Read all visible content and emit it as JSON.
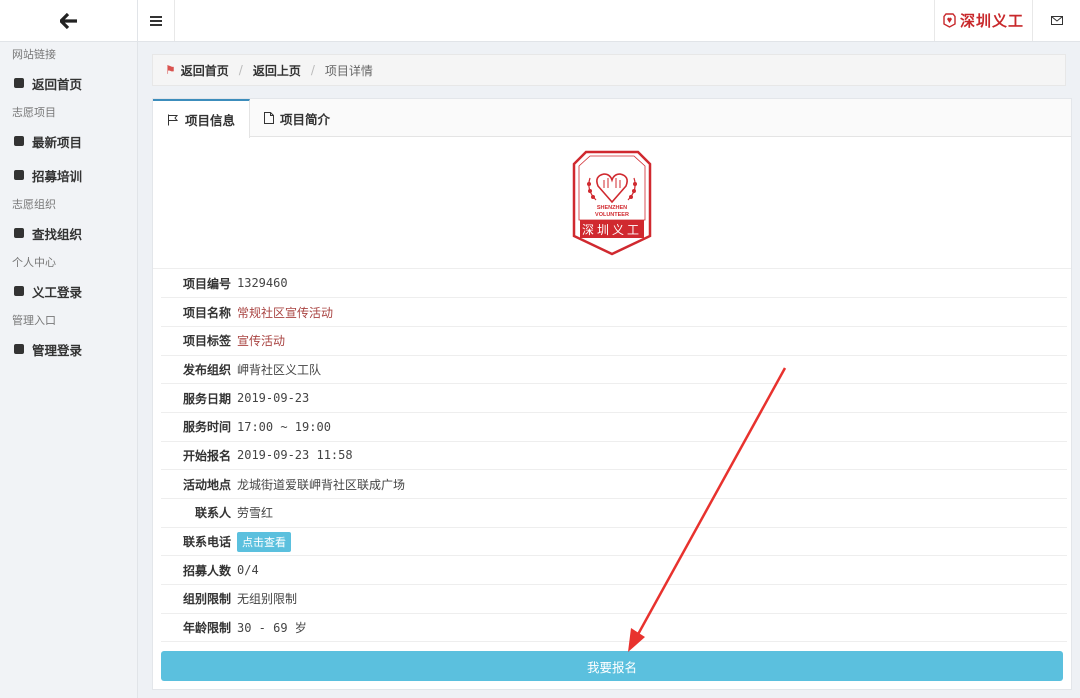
{
  "sidebar": {
    "sections": [
      {
        "title": "网站链接",
        "items": [
          {
            "label": "返回首页"
          }
        ]
      },
      {
        "title": "志愿项目",
        "items": [
          {
            "label": "最新项目"
          },
          {
            "label": "招募培训"
          }
        ]
      },
      {
        "title": "志愿组织",
        "items": [
          {
            "label": "查找组织"
          }
        ]
      },
      {
        "title": "个人中心",
        "items": [
          {
            "label": "义工登录"
          }
        ]
      },
      {
        "title": "管理入口",
        "items": [
          {
            "label": "管理登录"
          }
        ]
      }
    ]
  },
  "topbar": {
    "brand": "深圳义工",
    "menu_icon": "hamburger-icon",
    "mail_icon": "mail-icon"
  },
  "breadcrumb": {
    "home": "返回首页",
    "prev": "返回上页",
    "current": "项目详情"
  },
  "tabs": [
    {
      "label": "项目信息",
      "icon": "flag-icon"
    },
    {
      "label": "项目简介",
      "icon": "file-icon"
    }
  ],
  "logo": {
    "line1": "SHENZHEN",
    "line2": "VOLUNTEER",
    "name": "深圳义工"
  },
  "fields": {
    "id": {
      "label": "项目编号",
      "value": "1329460"
    },
    "name": {
      "label": "项目名称",
      "value": "常规社区宣传活动"
    },
    "tag": {
      "label": "项目标签",
      "value": "宣传活动"
    },
    "org": {
      "label": "发布组织",
      "value": "岬背社区义工队"
    },
    "date": {
      "label": "服务日期",
      "value": "2019-09-23"
    },
    "time": {
      "label": "服务时间",
      "value": "17:00 ~ 19:00"
    },
    "start": {
      "label": "开始报名",
      "value": "2019-09-23 11:58"
    },
    "place": {
      "label": "活动地点",
      "value": "龙城街道爱联岬背社区联成广场"
    },
    "contact": {
      "label": "联系人",
      "value": "劳雪红"
    },
    "phone": {
      "label": "联系电话",
      "button": "点击查看"
    },
    "quota": {
      "label": "招募人数",
      "value": "0/4"
    },
    "group": {
      "label": "组别限制",
      "value": "无组别限制"
    },
    "age": {
      "label": "年龄限制",
      "value": "30 - 69 岁"
    }
  },
  "signup_button": "我要报名",
  "colors": {
    "accent": "#5bc0de",
    "brand": "#c8282b",
    "tab_active": "#3c8dbc"
  }
}
